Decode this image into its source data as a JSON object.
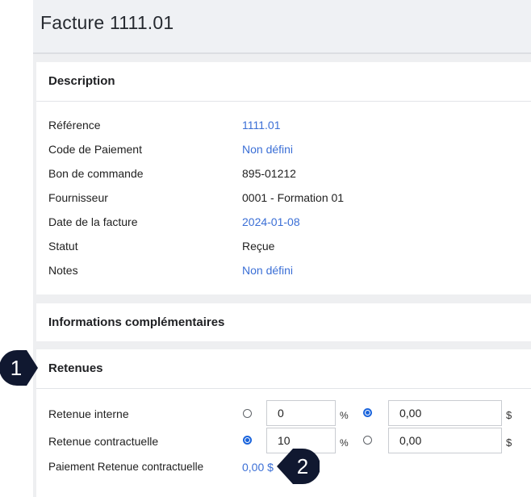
{
  "page": {
    "title": "Facture 1111.01"
  },
  "description": {
    "title": "Description",
    "rows": [
      {
        "label": "Référence",
        "value": "1111.01"
      },
      {
        "label": "Code de Paiement",
        "value": "Non défini"
      },
      {
        "label": "Bon de commande",
        "value": "895-01212"
      },
      {
        "label": "Fournisseur",
        "value": "0001 - Formation 01"
      },
      {
        "label": "Date de la facture",
        "value": "2024-01-08"
      },
      {
        "label": "Statut",
        "value": "Reçue"
      },
      {
        "label": "Notes",
        "value": "Non défini"
      }
    ]
  },
  "extra_info": {
    "title": "Informations complémentaires"
  },
  "retenues": {
    "title": "Retenues",
    "interne": {
      "label": "Retenue interne",
      "percent_value": "0",
      "percent_unit": "%",
      "amount_value": "0,00",
      "amount_unit": "$",
      "selected": "amount"
    },
    "contractuelle": {
      "label": "Retenue contractuelle",
      "percent_value": "10",
      "percent_unit": "%",
      "amount_value": "0,00",
      "amount_unit": "$",
      "selected": "percent"
    },
    "paiement": {
      "label": "Paiement Retenue contractuelle",
      "value": "0,00 $"
    }
  },
  "callouts": {
    "one": "1",
    "two": "2"
  },
  "colors": {
    "link": "#3b6fd6",
    "badge": "#101830",
    "radio_checked": "#1a64dc"
  }
}
